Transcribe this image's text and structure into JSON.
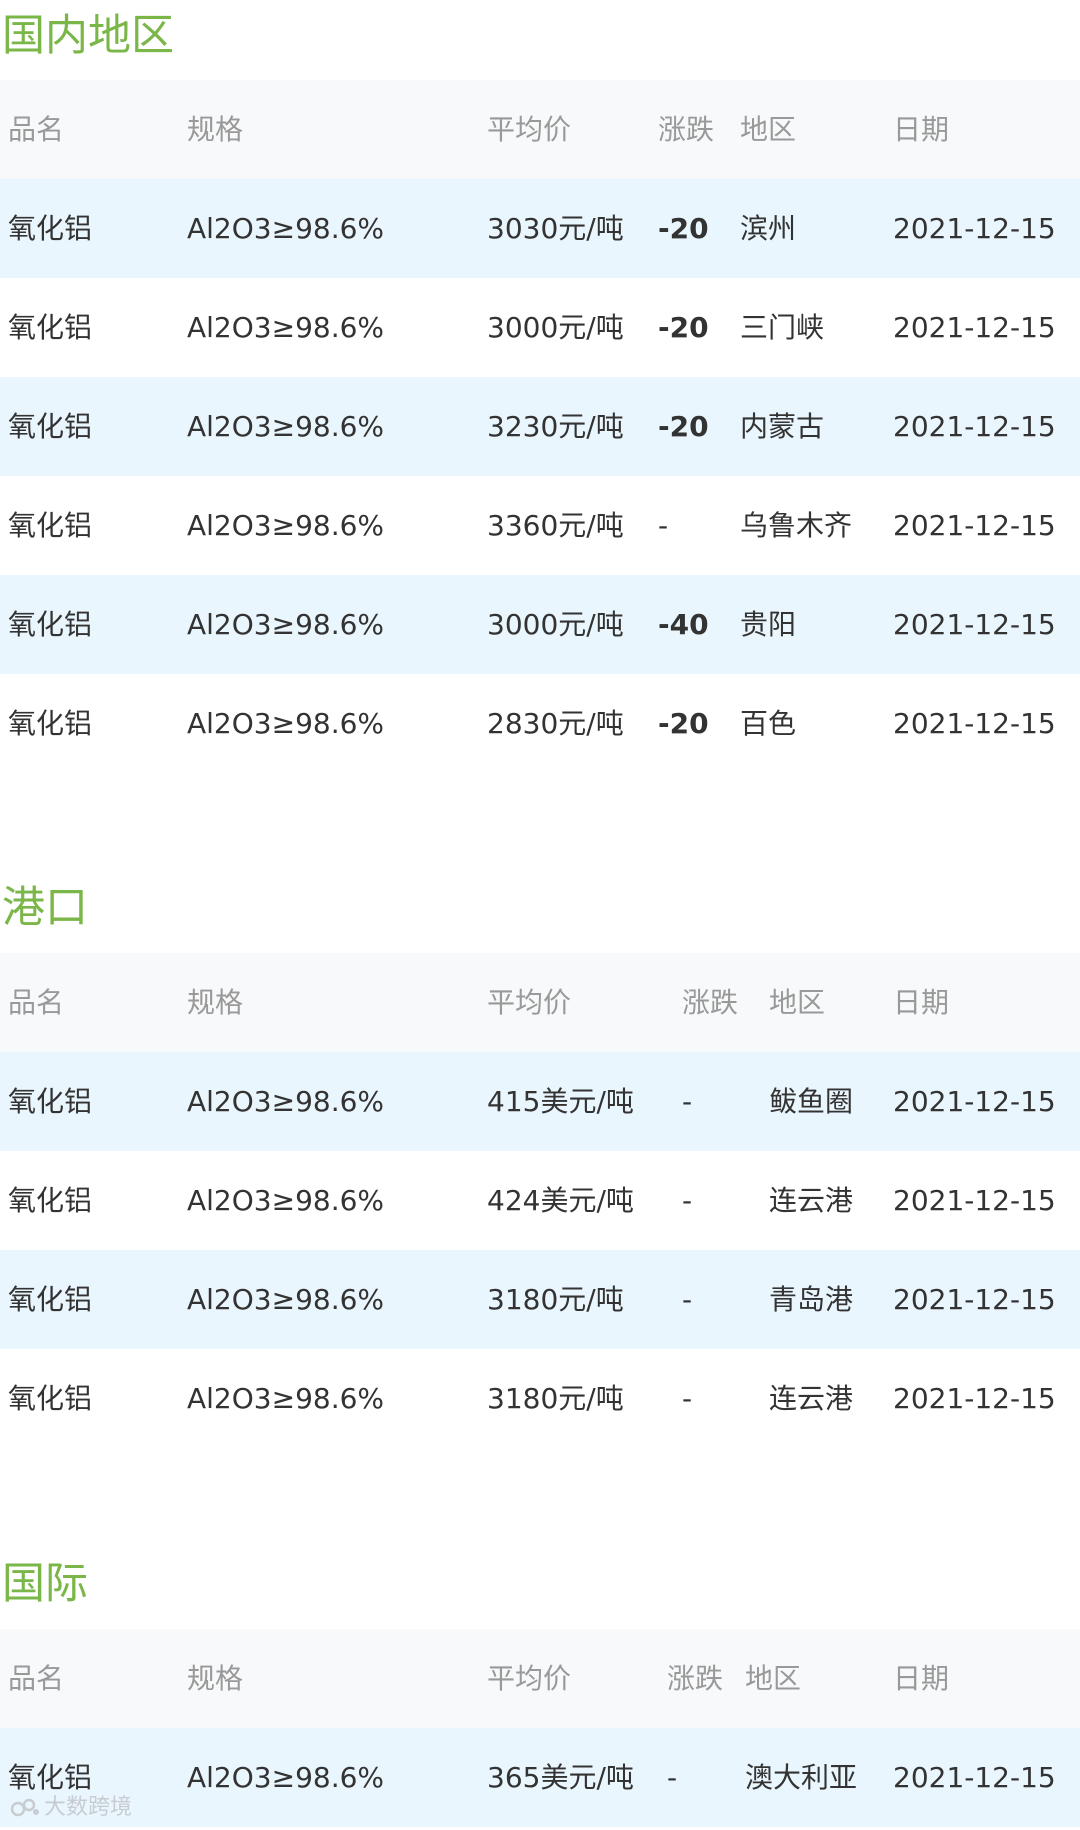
{
  "columns": [
    "品名",
    "规格",
    "平均价",
    "涨跌",
    "地区",
    "日期"
  ],
  "sections": [
    {
      "title": "国内地区",
      "rows": [
        {
          "name": "氧化铝",
          "spec": "Al2O3≥98.6%",
          "price": "3030元/吨",
          "change": "-20",
          "region": "滨州",
          "date": "2021-12-15"
        },
        {
          "name": "氧化铝",
          "spec": "Al2O3≥98.6%",
          "price": "3000元/吨",
          "change": "-20",
          "region": "三门峡",
          "date": "2021-12-15"
        },
        {
          "name": "氧化铝",
          "spec": "Al2O3≥98.6%",
          "price": "3230元/吨",
          "change": "-20",
          "region": "内蒙古",
          "date": "2021-12-15"
        },
        {
          "name": "氧化铝",
          "spec": "Al2O3≥98.6%",
          "price": "3360元/吨",
          "change": "-",
          "region": "乌鲁木齐",
          "date": "2021-12-15"
        },
        {
          "name": "氧化铝",
          "spec": "Al2O3≥98.6%",
          "price": "3000元/吨",
          "change": "-40",
          "region": "贵阳",
          "date": "2021-12-15"
        },
        {
          "name": "氧化铝",
          "spec": "Al2O3≥98.6%",
          "price": "2830元/吨",
          "change": "-20",
          "region": "百色",
          "date": "2021-12-15"
        }
      ]
    },
    {
      "title": "港口",
      "rows": [
        {
          "name": "氧化铝",
          "spec": "Al2O3≥98.6%",
          "price": "415美元/吨",
          "change": "-",
          "region": "鲅鱼圈",
          "date": "2021-12-15"
        },
        {
          "name": "氧化铝",
          "spec": "Al2O3≥98.6%",
          "price": "424美元/吨",
          "change": "-",
          "region": "连云港",
          "date": "2021-12-15"
        },
        {
          "name": "氧化铝",
          "spec": "Al2O3≥98.6%",
          "price": "3180元/吨",
          "change": "-",
          "region": "青岛港",
          "date": "2021-12-15"
        },
        {
          "name": "氧化铝",
          "spec": "Al2O3≥98.6%",
          "price": "3180元/吨",
          "change": "-",
          "region": "连云港",
          "date": "2021-12-15"
        }
      ]
    },
    {
      "title": "国际",
      "rows": [
        {
          "name": "氧化铝",
          "spec": "Al2O3≥98.6%",
          "price": "365美元/吨",
          "change": "-",
          "region": "澳大利亚",
          "date": "2021-12-15"
        }
      ]
    }
  ],
  "watermark": {
    "text": "大数跨境",
    "icon": "brand-logo-icon"
  },
  "colors": {
    "section_title": "#7ab648",
    "price_down": "#7ab648",
    "row_shaded": "#eaf6fd",
    "header_bg": "#f8f9fa",
    "header_text": "#999999",
    "body_text": "#333333"
  }
}
